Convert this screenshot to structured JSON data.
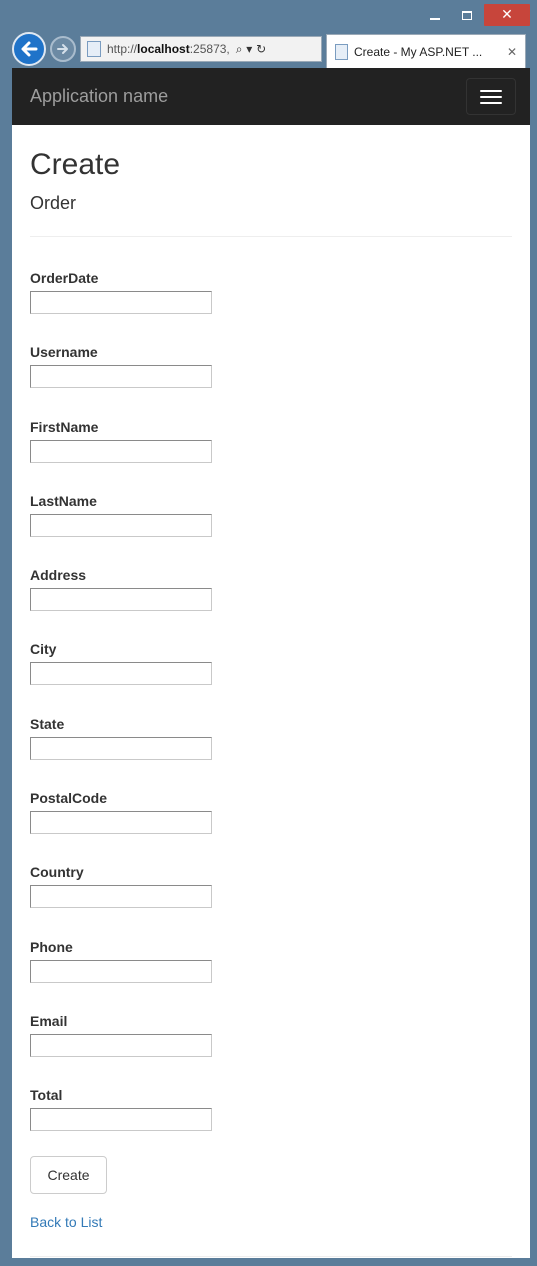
{
  "browser": {
    "url_prefix": "http://",
    "url_host": "localhost",
    "url_port": ":25873,",
    "address_icons": "⌕ ▾ ↻",
    "tab_title": "Create - My ASP.NET ...",
    "tab_close": "✕",
    "window_close": "✕"
  },
  "navbar": {
    "brand": "Application name"
  },
  "page": {
    "title": "Create",
    "subtitle": "Order"
  },
  "form": {
    "fields": [
      {
        "label": "OrderDate",
        "value": ""
      },
      {
        "label": "Username",
        "value": ""
      },
      {
        "label": "FirstName",
        "value": ""
      },
      {
        "label": "LastName",
        "value": ""
      },
      {
        "label": "Address",
        "value": ""
      },
      {
        "label": "City",
        "value": ""
      },
      {
        "label": "State",
        "value": ""
      },
      {
        "label": "PostalCode",
        "value": ""
      },
      {
        "label": "Country",
        "value": ""
      },
      {
        "label": "Phone",
        "value": ""
      },
      {
        "label": "Email",
        "value": ""
      },
      {
        "label": "Total",
        "value": ""
      }
    ],
    "submit_label": "Create",
    "back_link": "Back to List"
  },
  "colors": {
    "window_frame": "#5b7d9a",
    "navbar_bg": "#222222",
    "link": "#337ab7",
    "close_button": "#c7453b"
  }
}
